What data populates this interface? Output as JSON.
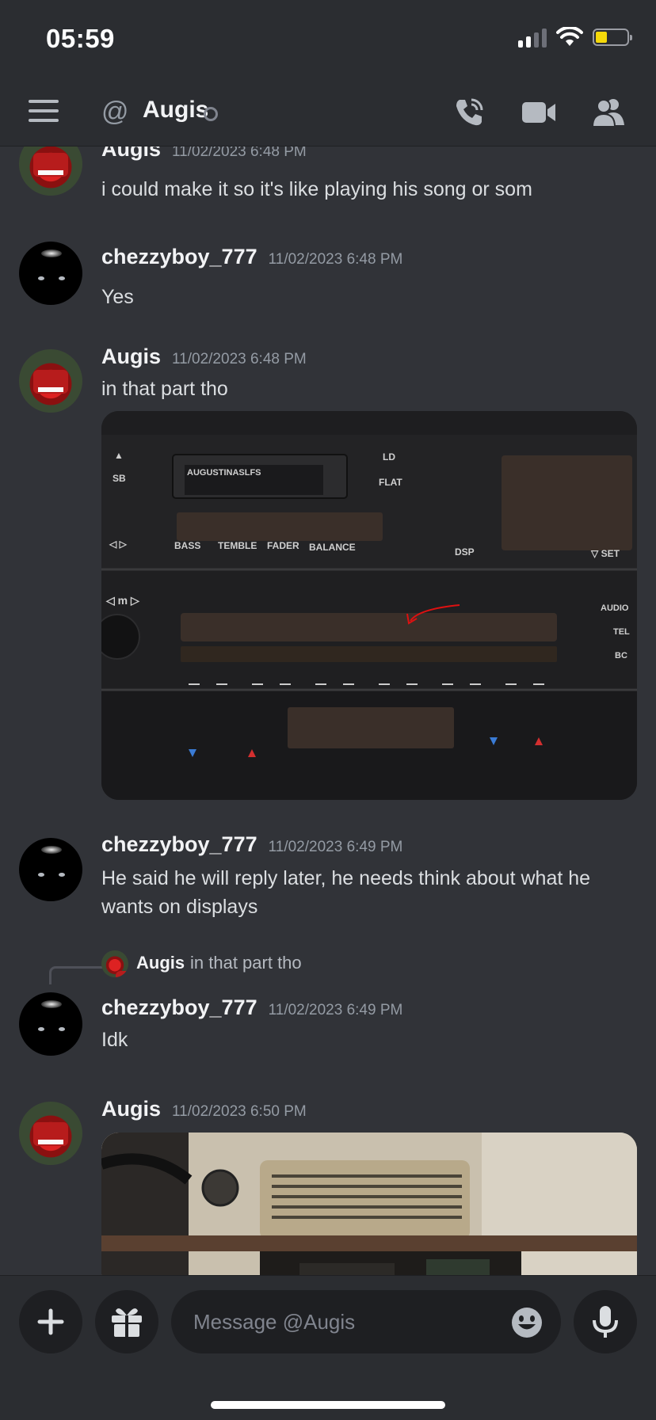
{
  "status_bar": {
    "time": "05:59"
  },
  "header": {
    "channel_name": "Augis"
  },
  "messages": [
    {
      "author": "Augis",
      "timestamp": "11/02/2023 6:48 PM",
      "text": "i could make it so it's like playing his song or som"
    },
    {
      "author": "chezzyboy_777",
      "timestamp": "11/02/2023 6:48 PM",
      "text": "Yes"
    },
    {
      "author": "Augis",
      "timestamp": "11/02/2023 6:48 PM",
      "text": "in that part tho"
    },
    {
      "author": "chezzyboy_777",
      "timestamp": "11/02/2023 6:49 PM",
      "text": "He said he will reply later, he needs think about what he wants on displays"
    },
    {
      "author": "chezzyboy_777",
      "timestamp": "11/02/2023 6:49 PM",
      "text": "Idk",
      "reply_to": {
        "author": "Augis",
        "text": "in that part tho"
      }
    },
    {
      "author": "Augis",
      "timestamp": "11/02/2023 6:50 PM",
      "text": ""
    }
  ],
  "radio_image": {
    "labels": {
      "eject": "▲",
      "sb": "SB",
      "display_text": "AUGUSTINASLFS",
      "ld": "LD",
      "flat": "FLAT",
      "seek": "◁   ▷",
      "bass": "BASS",
      "treble": "TEMBLE",
      "fader": "FADER",
      "balance": "BALANCE",
      "dsp": "DSP",
      "set": "▽ SET",
      "mode": "◁ m ▷",
      "audio": "AUDIO",
      "tel": "TEL",
      "bc": "BC"
    }
  },
  "composer": {
    "placeholder": "Message @Augis"
  }
}
